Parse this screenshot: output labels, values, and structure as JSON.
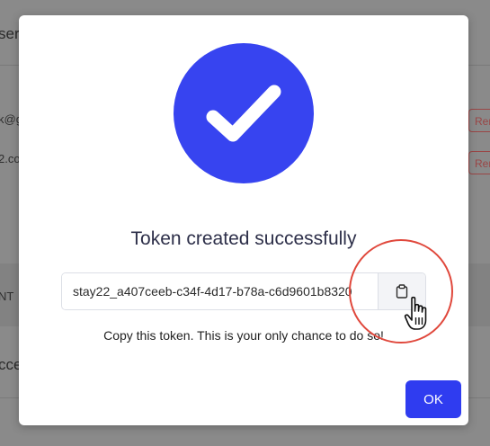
{
  "background": {
    "heading_fragment": "ser",
    "row1_fragment": "k@g",
    "row2_fragment": "2.co",
    "remove_label": "Rem",
    "section_fragment": "NT",
    "lower_fragment": "cce"
  },
  "modal": {
    "icon": "check-circle-icon",
    "title": "Token created successfully",
    "token_value": "stay22_a407ceeb-c34f-4d17-b78a-c6d9601b8320",
    "copy_icon": "clipboard-icon",
    "hint": "Copy this token. This is your only chance to do so!",
    "ok_label": "OK"
  },
  "colors": {
    "accent": "#3744f0",
    "ok_button": "#2f3cf0",
    "highlight_ring": "#e0483c"
  }
}
